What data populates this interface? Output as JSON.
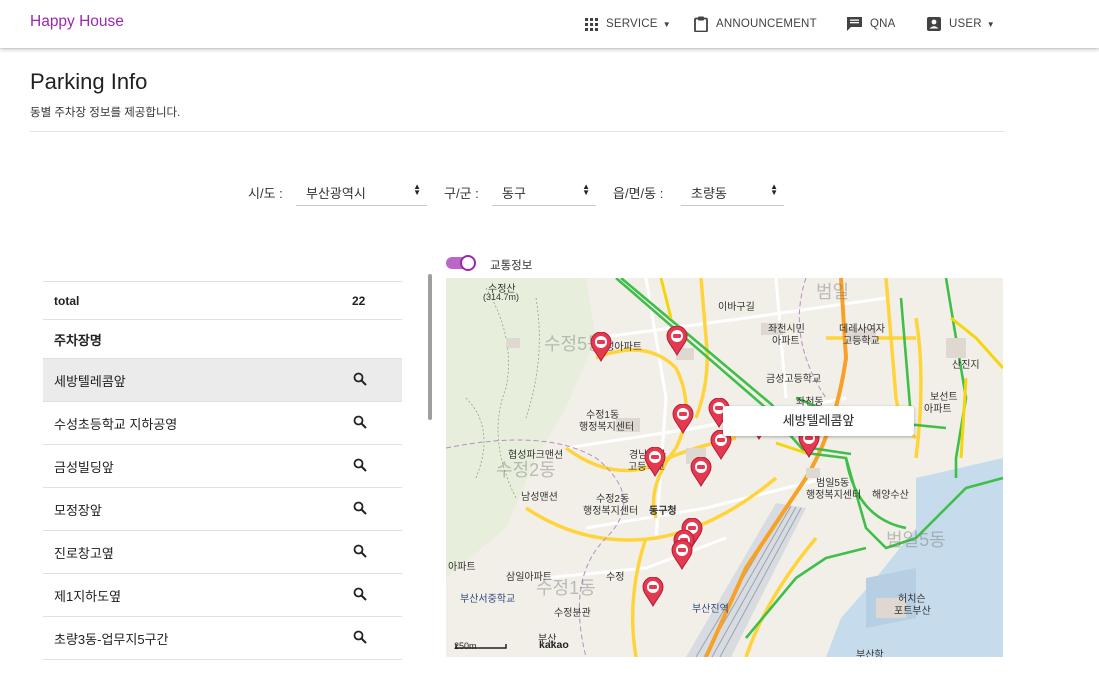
{
  "header": {
    "brand": "Happy House",
    "nav": [
      {
        "label": "SERVICE",
        "icon": "grid-icon",
        "dropdown": true
      },
      {
        "label": "ANNOUNCEMENT",
        "icon": "clipboard-icon",
        "dropdown": false
      },
      {
        "label": "QNA",
        "icon": "chat-icon",
        "dropdown": false
      },
      {
        "label": "USER",
        "icon": "account-box-icon",
        "dropdown": true
      }
    ]
  },
  "page": {
    "title": "Parking Info",
    "subtitle": "동별 주차장 정보를 제공합니다."
  },
  "filters": {
    "sido_label": "시/도 :",
    "sido_value": "부산광역시",
    "gugun_label": "구/군 :",
    "gugun_value": "동구",
    "dong_label": "읍/면/동 :",
    "dong_value": "초량동"
  },
  "table": {
    "total_label": "total",
    "total_count": "22",
    "column_header": "주차장명",
    "rows": [
      "세방텔레콤앞",
      "수성초등학교 지하공영",
      "금성빌딩앞",
      "모정장앞",
      "진로창고옆",
      "제1지하도옆",
      "초량3동-업무지5구간"
    ]
  },
  "traffic_toggle": {
    "label": "교통정보",
    "on": true
  },
  "map": {
    "selected_tooltip": "세방텔레콤앞",
    "scale": "250m",
    "provider": "kakao",
    "labels": {
      "l1": "수정산",
      "l2": "(314.7m)",
      "l3": "수정5동",
      "l4": "수성아파트",
      "l5": "이바구길",
      "l6": "좌천시민",
      "l7": "아파트",
      "l8": "데레사여자",
      "l9": "고등학교",
      "l10": "금성고등학교",
      "l11": "좌천동",
      "l12": "수정1동",
      "l13": "행정복지센터",
      "l14": "협성파크맨션",
      "l15": "경남여자",
      "l16": "고등학교",
      "l17": "수정2동",
      "l18": "남성맨션",
      "l19": "수정2동",
      "l20": "행정복지센터",
      "l21": "동구청",
      "l22": "범일5동",
      "l23": "행정복지센터",
      "l24": "해양수산",
      "l25": "범일5동",
      "l26": "부산서중학교",
      "l27": "수정분관",
      "l28": "수정",
      "l29": "부산진역",
      "l30": "허치슨",
      "l31": "포트부산",
      "l32": "부산항",
      "l33": "아파트",
      "l34": "수정1동",
      "l35": "산진지",
      "l36": "보선트",
      "l37": "아파트",
      "l38": "범일",
      "l39": "부산",
      "l40": "삼일아파트"
    }
  },
  "colors": {
    "brand": "#9c27b0",
    "toggle": "#ba68c8",
    "pin": "#e53950"
  }
}
